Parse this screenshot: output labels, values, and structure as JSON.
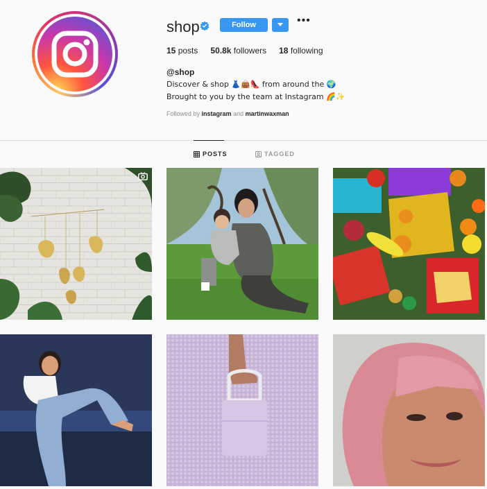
{
  "profile": {
    "username": "shop",
    "verified": true,
    "follow_label": "Follow",
    "more_label": "•••",
    "stats": {
      "posts_count": "15",
      "posts_label": "posts",
      "followers_count": "50.8k",
      "followers_label": "followers",
      "following_count": "18",
      "following_label": "following"
    },
    "bio": {
      "name": "@shop",
      "line1": "Discover & shop 👗👜👠 from around the 🌍",
      "line2": "Brought to you by the team at Instagram 🌈✨"
    },
    "followed_by": {
      "prefix": "Followed by",
      "user1": "instagram",
      "conjunction": "and",
      "user2": "martinwaxman"
    }
  },
  "tabs": {
    "posts": "POSTS",
    "tagged": "TAGGED"
  },
  "colors": {
    "accent": "#3897f0",
    "verified": "#3897f0"
  },
  "posts": [
    {
      "id": 1,
      "description": "Monstera leaf mobile with golden leaves",
      "icon": "igtv-icon"
    },
    {
      "id": 2,
      "description": "Woman with child sitting on grass"
    },
    {
      "id": 3,
      "description": "Colorful beaded bags with fruit"
    },
    {
      "id": 4,
      "description": "Woman in jeans sitting on blue bench"
    },
    {
      "id": 5,
      "description": "Hand holding lavender handbag"
    },
    {
      "id": 6,
      "description": "Woman with pink hair winking"
    }
  ]
}
